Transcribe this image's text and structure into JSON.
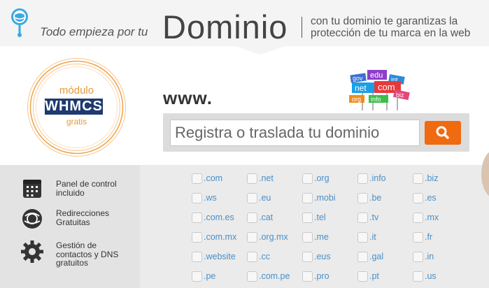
{
  "header": {
    "tagline": "Todo empieza por tu",
    "title": "Dominio",
    "slogan_line1": "con tu dominio te garantizas la",
    "slogan_line2": "protección de tu marca en la web"
  },
  "badge": {
    "modulo": "módulo",
    "brand": "WHMCS",
    "gratis": "gratis"
  },
  "search": {
    "prefix": "www.",
    "placeholder": "Registra o traslada tu dominio",
    "value": ""
  },
  "tag_cloud": [
    "edu",
    "net",
    "com",
    "gov",
    "int",
    "biz",
    "org",
    "info"
  ],
  "features": [
    {
      "icon": "control-panel-icon",
      "line1": "Panel de control",
      "line2": "incluido",
      "line3": ""
    },
    {
      "icon": "globe-redirect-icon",
      "line1": "Redirecciones",
      "line2": "Gratuitas",
      "line3": ""
    },
    {
      "icon": "gear-icon",
      "line1": "Gestión de",
      "line2": "contactos y DNS",
      "line3": "gratuitos"
    }
  ],
  "extensions": [
    [
      ".com",
      ".net",
      ".org",
      ".info",
      ".biz"
    ],
    [
      ".ws",
      ".eu",
      ".mobi",
      ".be",
      ".es"
    ],
    [
      ".com.es",
      ".cat",
      ".tel",
      ".tv",
      ".mx"
    ],
    [
      ".com.mx",
      ".org.mx",
      ".me",
      ".it",
      ".fr"
    ],
    [
      ".website",
      ".cc",
      ".eus",
      ".gal",
      ".in"
    ],
    [
      ".pe",
      ".com.pe",
      ".pro",
      ".pt",
      ".us"
    ]
  ],
  "colors": {
    "accent": "#f06a10",
    "link": "#4a8fc7",
    "badge_ring": "#f0a348",
    "brand_blue": "#1e3a6e"
  }
}
